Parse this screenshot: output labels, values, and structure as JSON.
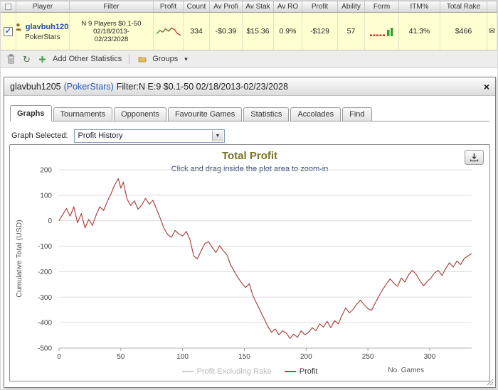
{
  "colors": {
    "accent_blue": "#1f4fa0",
    "negative_red": "#cc0000",
    "row_highlight": "#ffffd2",
    "chart_line": "#aa4643",
    "hidden_series_gray": "#cccccc",
    "spark_up": "#2e8b2e",
    "spark_down": "#cc3333",
    "form_red": "#cc2e2e",
    "form_green": "#2fa52f"
  },
  "icons": {
    "refresh": "↻",
    "caret_down": "▾",
    "select_arrow": "▼",
    "check": "✓",
    "envelope": "✉",
    "close": "×"
  },
  "table": {
    "headers": {
      "player": "Player",
      "filter": "Filter",
      "profit_graph": "Profit",
      "count": "Count",
      "av_profit": "Av Profi",
      "av_stake": "Av Stak",
      "av_roi": "Av RO",
      "profit": "Profit",
      "ability": "Ability",
      "form": "Form",
      "itm": "ITM%",
      "total_rake": "Total Rake"
    },
    "row": {
      "player_name": "glavbuh1205",
      "site": "PokerStars",
      "filter_line1": "N 9 Players $0.1-50",
      "filter_line2": "02/18/2013-",
      "filter_line3": "02/23/2028",
      "count": "334",
      "av_profit": "-$0.39",
      "av_stake": "$15.36",
      "av_roi": "0.9%",
      "profit": "-$129",
      "ability": "57",
      "itm": "41.3%",
      "total_rake": "$466",
      "sparkline_values": [
        1,
        3,
        2,
        4,
        2.5,
        4.5,
        3.5,
        1,
        0
      ],
      "form": {
        "red_dashes": 5,
        "green_bars": [
          9,
          12
        ]
      }
    }
  },
  "toolbar": {
    "add_stats_label": "Add Other Statistics",
    "groups_label": "Groups"
  },
  "popup": {
    "title_player": "glavbuh1205",
    "title_site": "(PokerStars)",
    "title_filter": "Filter:N E:9 $0.1-50 02/18/2013-02/23/2028",
    "tabs": [
      "Graphs",
      "Tournaments",
      "Opponents",
      "Favourite Games",
      "Statistics",
      "Accolades",
      "Find"
    ],
    "active_tab": 0,
    "graph_selected_label": "Graph Selected:",
    "graph_selected_value": "Profit History"
  },
  "chart_data": {
    "type": "line",
    "title": "Total Profit",
    "subtitle": "Click and drag inside the plot area to zoom-in",
    "ylabel": "Cumulative Total (USD)",
    "xlabel": "No. Games",
    "ylim": [
      -500,
      200
    ],
    "ytick_step": 100,
    "xlim": [
      0,
      334
    ],
    "xticks": [
      0,
      50,
      100,
      150,
      200,
      250,
      300
    ],
    "grid": true,
    "legend_position": "bottom",
    "legend": [
      {
        "name": "Profit Excluding Rake",
        "color": "#cccccc",
        "hidden": true
      },
      {
        "name": "Profit",
        "color": "#aa4643",
        "hidden": false
      }
    ],
    "series": [
      {
        "name": "Profit",
        "color": "#aa4643",
        "points": [
          [
            0,
            0
          ],
          [
            3,
            25
          ],
          [
            6,
            48
          ],
          [
            9,
            18
          ],
          [
            12,
            55
          ],
          [
            15,
            -8
          ],
          [
            18,
            28
          ],
          [
            21,
            -28
          ],
          [
            24,
            5
          ],
          [
            27,
            -18
          ],
          [
            30,
            22
          ],
          [
            33,
            55
          ],
          [
            36,
            40
          ],
          [
            39,
            75
          ],
          [
            42,
            105
          ],
          [
            45,
            140
          ],
          [
            48,
            165
          ],
          [
            50,
            128
          ],
          [
            52,
            152
          ],
          [
            55,
            85
          ],
          [
            58,
            60
          ],
          [
            61,
            78
          ],
          [
            64,
            45
          ],
          [
            67,
            62
          ],
          [
            70,
            88
          ],
          [
            73,
            65
          ],
          [
            76,
            80
          ],
          [
            79,
            45
          ],
          [
            82,
            8
          ],
          [
            85,
            -30
          ],
          [
            88,
            -55
          ],
          [
            91,
            -65
          ],
          [
            94,
            -38
          ],
          [
            97,
            -52
          ],
          [
            100,
            -60
          ],
          [
            103,
            -42
          ],
          [
            106,
            -75
          ],
          [
            109,
            -138
          ],
          [
            112,
            -150
          ],
          [
            115,
            -118
          ],
          [
            118,
            -90
          ],
          [
            121,
            -82
          ],
          [
            124,
            -105
          ],
          [
            127,
            -125
          ],
          [
            130,
            -98
          ],
          [
            133,
            -118
          ],
          [
            136,
            -135
          ],
          [
            139,
            -175
          ],
          [
            142,
            -200
          ],
          [
            145,
            -225
          ],
          [
            148,
            -245
          ],
          [
            151,
            -262
          ],
          [
            154,
            -248
          ],
          [
            157,
            -295
          ],
          [
            160,
            -325
          ],
          [
            163,
            -355
          ],
          [
            166,
            -385
          ],
          [
            169,
            -415
          ],
          [
            172,
            -438
          ],
          [
            175,
            -425
          ],
          [
            178,
            -448
          ],
          [
            181,
            -432
          ],
          [
            184,
            -442
          ],
          [
            187,
            -462
          ],
          [
            190,
            -445
          ],
          [
            193,
            -458
          ],
          [
            196,
            -432
          ],
          [
            199,
            -448
          ],
          [
            202,
            -438
          ],
          [
            205,
            -420
          ],
          [
            208,
            -432
          ],
          [
            211,
            -405
          ],
          [
            214,
            -418
          ],
          [
            217,
            -395
          ],
          [
            220,
            -420
          ],
          [
            223,
            -392
          ],
          [
            226,
            -405
          ],
          [
            229,
            -372
          ],
          [
            232,
            -342
          ],
          [
            235,
            -362
          ],
          [
            238,
            -348
          ],
          [
            241,
            -328
          ],
          [
            244,
            -312
          ],
          [
            247,
            -330
          ],
          [
            250,
            -345
          ],
          [
            253,
            -352
          ],
          [
            256,
            -322
          ],
          [
            259,
            -295
          ],
          [
            262,
            -270
          ],
          [
            265,
            -248
          ],
          [
            268,
            -228
          ],
          [
            271,
            -245
          ],
          [
            274,
            -258
          ],
          [
            277,
            -225
          ],
          [
            280,
            -240
          ],
          [
            283,
            -212
          ],
          [
            286,
            -195
          ],
          [
            289,
            -210
          ],
          [
            292,
            -235
          ],
          [
            295,
            -255
          ],
          [
            298,
            -238
          ],
          [
            301,
            -225
          ],
          [
            304,
            -205
          ],
          [
            307,
            -195
          ],
          [
            310,
            -215
          ],
          [
            313,
            -188
          ],
          [
            316,
            -165
          ],
          [
            319,
            -182
          ],
          [
            322,
            -158
          ],
          [
            325,
            -172
          ],
          [
            328,
            -148
          ],
          [
            331,
            -138
          ],
          [
            334,
            -129
          ]
        ]
      }
    ]
  }
}
